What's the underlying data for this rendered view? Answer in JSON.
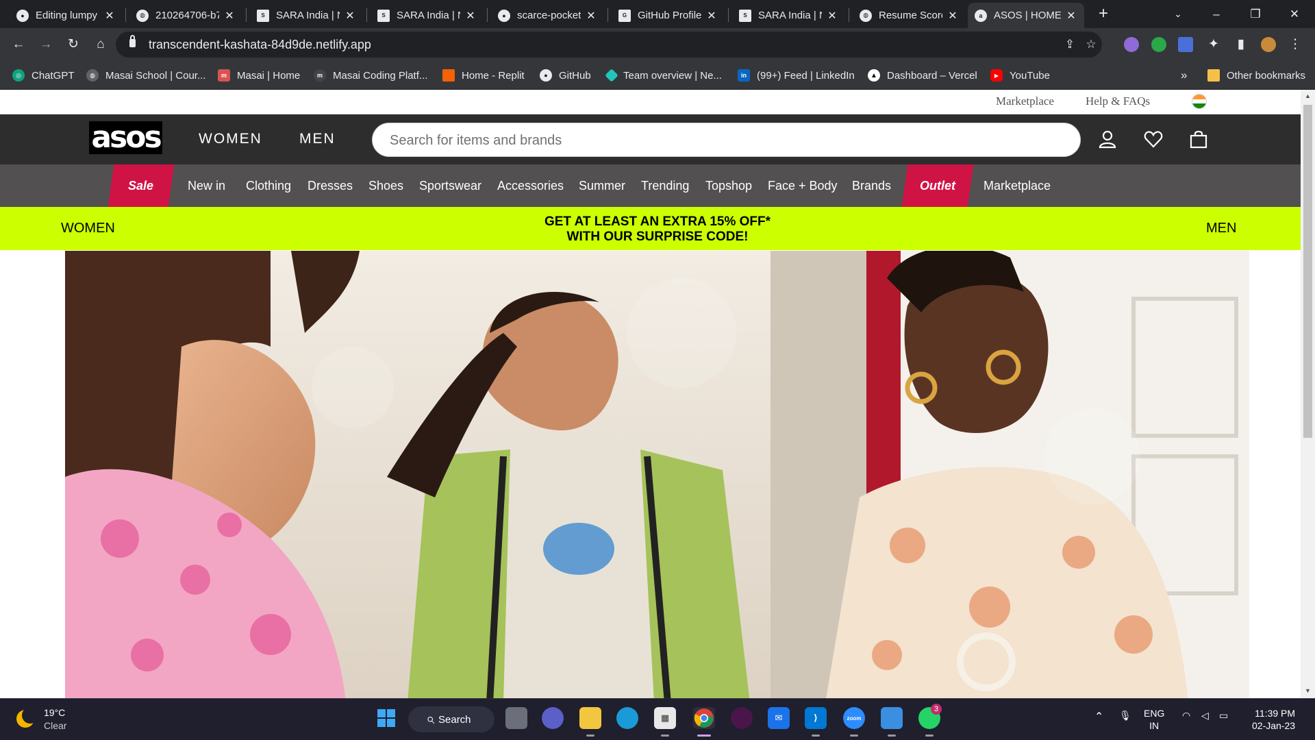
{
  "browser": {
    "tabs": [
      {
        "title": "Editing lumpy",
        "icon": "github-icon"
      },
      {
        "title": "210264706-b7",
        "icon": "globe-icon"
      },
      {
        "title": "SARA India | N",
        "icon": "sara-icon"
      },
      {
        "title": "SARA India | N",
        "icon": "sara-icon"
      },
      {
        "title": "scarce-pocket",
        "icon": "github-icon"
      },
      {
        "title": "GitHub Profile",
        "icon": "github-profile-icon"
      },
      {
        "title": "SARA India | N",
        "icon": "sara-icon"
      },
      {
        "title": "Resume Score",
        "icon": "globe-icon"
      },
      {
        "title": "ASOS | HOME",
        "icon": "asos-icon",
        "active": true
      }
    ],
    "url": "transcendent-kashata-84d9de.netlify.app",
    "bookmarks": [
      {
        "label": "ChatGPT",
        "icon": "chatgpt-icon",
        "color": "#10a37f"
      },
      {
        "label": "Masai School | Cour...",
        "icon": "masai-icon",
        "color": "#e8eaed"
      },
      {
        "label": "Masai | Home",
        "icon": "masai-home-icon",
        "color": "#e8eaed"
      },
      {
        "label": "Masai Coding Platf...",
        "icon": "masai-coding-icon",
        "color": "#e8eaed"
      },
      {
        "label": "Home - Replit",
        "icon": "replit-icon",
        "color": "#f26207"
      },
      {
        "label": "GitHub",
        "icon": "github-icon",
        "color": "#e8eaed"
      },
      {
        "label": "Team overview | Ne...",
        "icon": "netlify-icon",
        "color": "#20c6b7"
      },
      {
        "label": "(99+) Feed | LinkedIn",
        "icon": "linkedin-icon",
        "color": "#0a66c2"
      },
      {
        "label": "Dashboard – Vercel",
        "icon": "vercel-icon",
        "color": "#ffffff"
      },
      {
        "label": "YouTube",
        "icon": "youtube-icon",
        "color": "#ff0000"
      }
    ],
    "more_bookmarks": "»",
    "other_bookmarks": "Other bookmarks"
  },
  "site": {
    "utility_links": [
      "Marketplace",
      "Help & FAQs"
    ],
    "logo": "asos",
    "gender_tabs": [
      "WOMEN",
      "MEN"
    ],
    "search_placeholder": "Search for items and brands",
    "categories": [
      "Sale",
      "New in",
      "Clothing",
      "Dresses",
      "Shoes",
      "Sportswear",
      "Accessories",
      "Summer",
      "Trending",
      "Topshop",
      "Face + Body",
      "Brands",
      "Outlet",
      "Marketplace"
    ],
    "highlight_color": "#d01345",
    "promo": {
      "left": "WOMEN",
      "line1": "GET AT LEAST AN EXTRA 15% OFF*",
      "line2": "WITH OUR SURPRISE CODE!",
      "right": "MEN",
      "color": "#ccff00"
    }
  },
  "taskbar": {
    "weather_temp": "19°C",
    "weather_desc": "Clear",
    "search_label": "Search",
    "lang": "ENG",
    "region": "IN",
    "time": "11:39 PM",
    "date": "02-Jan-23",
    "whatsapp_badge": "3"
  }
}
